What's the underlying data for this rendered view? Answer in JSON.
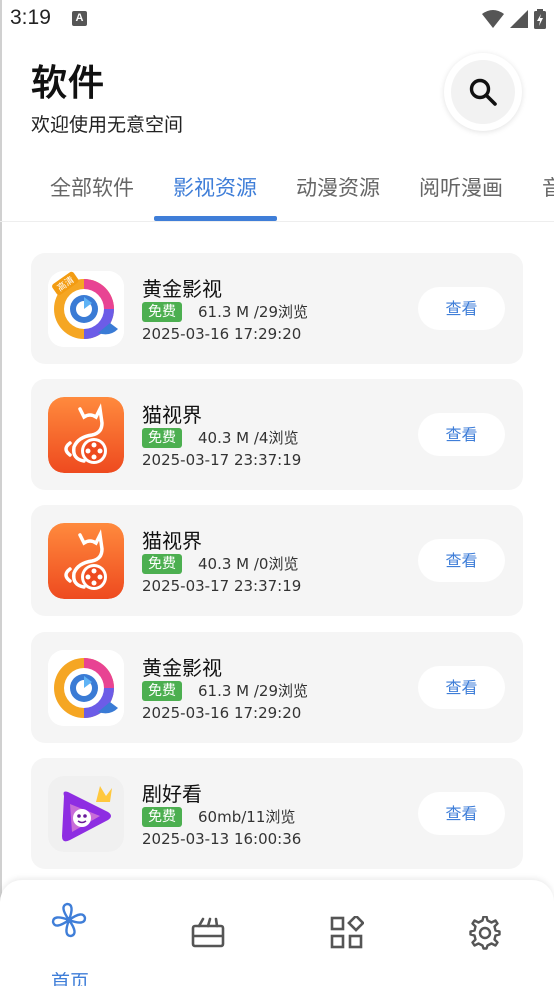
{
  "status_bar": {
    "time": "3:19",
    "notification_icon": "A"
  },
  "header": {
    "title": "软件",
    "subtitle": "欢迎使用无意空间",
    "search_icon": "search-icon"
  },
  "tabs": [
    {
      "label": "全部软件",
      "active": false
    },
    {
      "label": "影视资源",
      "active": true
    },
    {
      "label": "动漫资源",
      "active": false
    },
    {
      "label": "阅听漫画",
      "active": false
    },
    {
      "label": "音",
      "active": false
    }
  ],
  "apps": [
    {
      "name": "黄金影视",
      "badge": "免费",
      "meta": "61.3 M /29浏览",
      "date": "2025-03-16 17:29:20",
      "action": "查看",
      "icon": "golden-video-icon",
      "corner_tag": "高清"
    },
    {
      "name": "猫视界",
      "badge": "免费",
      "meta": "40.3 M /4浏览",
      "date": "2025-03-17 23:37:19",
      "action": "查看",
      "icon": "cat-view-icon"
    },
    {
      "name": "猫视界",
      "badge": "免费",
      "meta": "40.3 M /0浏览",
      "date": "2025-03-17 23:37:19",
      "action": "查看",
      "icon": "cat-view-icon"
    },
    {
      "name": "黄金影视",
      "badge": "免费",
      "meta": "61.3 M /29浏览",
      "date": "2025-03-16 17:29:20",
      "action": "查看",
      "icon": "golden-video-icon"
    },
    {
      "name": "剧好看",
      "badge": "免费",
      "meta": "60mb/11浏览",
      "date": "2025-03-13 16:00:36",
      "action": "查看",
      "icon": "drama-play-icon"
    }
  ],
  "bottom_nav": [
    {
      "label": "首页",
      "icon": "pinwheel-icon",
      "active": true
    },
    {
      "label": "",
      "icon": "tv-box-icon",
      "active": false
    },
    {
      "label": "",
      "icon": "apps-grid-icon",
      "active": false
    },
    {
      "label": "",
      "icon": "gear-icon",
      "active": false
    }
  ],
  "colors": {
    "accent": "#3f7ed8",
    "badge": "#4caf50",
    "card_bg": "#f5f5f5"
  }
}
